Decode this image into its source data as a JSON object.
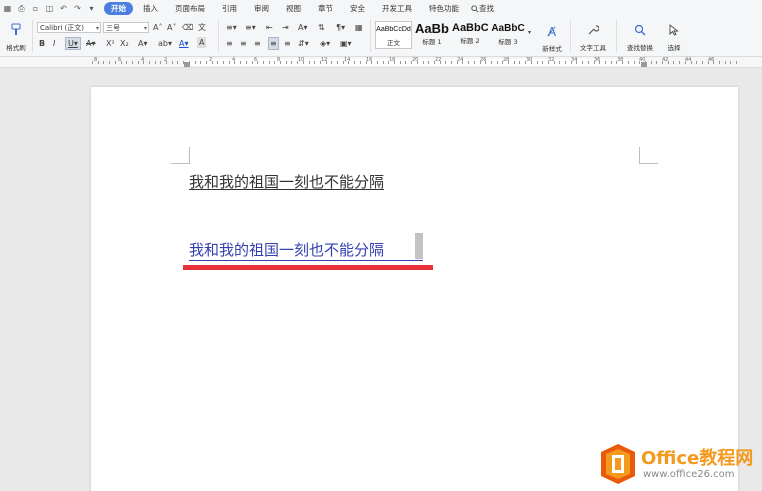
{
  "menubar": {
    "tabs": [
      "开始",
      "插入",
      "页面布局",
      "引用",
      "审阅",
      "视图",
      "章节",
      "安全",
      "开发工具",
      "特色功能"
    ],
    "active_tab": "开始",
    "search_label": "查找"
  },
  "ribbon": {
    "format_painter_label": "格式刷",
    "font_name": "Calibri (正文)",
    "font_size": "三号",
    "styles": [
      {
        "preview": "AaBbCcDd",
        "label": "正文"
      },
      {
        "preview": "AaBb",
        "label": "标题 1"
      },
      {
        "preview": "AaBbC",
        "label": "标题 2"
      },
      {
        "preview": "AaBbC",
        "label": "标题 3"
      }
    ],
    "new_style_label": "新样式",
    "text_tools_label": "文字工具",
    "find_replace_label": "查找替换",
    "select_label": "选择"
  },
  "ruler": {
    "numbers": [
      "8",
      "6",
      "4",
      "2",
      "2",
      "4",
      "6",
      "8",
      "10",
      "12",
      "14",
      "16",
      "18",
      "20",
      "22",
      "24",
      "26",
      "28",
      "30",
      "32",
      "34",
      "36",
      "38",
      "40",
      "42",
      "44",
      "46"
    ]
  },
  "document": {
    "line1": "我和我的祖国一刻也不能分隔",
    "line2": "我和我的祖国一刻也不能分隔"
  },
  "watermark": {
    "brand": "Office教程网",
    "url": "www.office26.com"
  },
  "colors": {
    "accent": "#4a7fe0",
    "red_marker": "#e8313a",
    "blue_text": "#3340b0",
    "watermark_orange": "#f39a1e"
  }
}
